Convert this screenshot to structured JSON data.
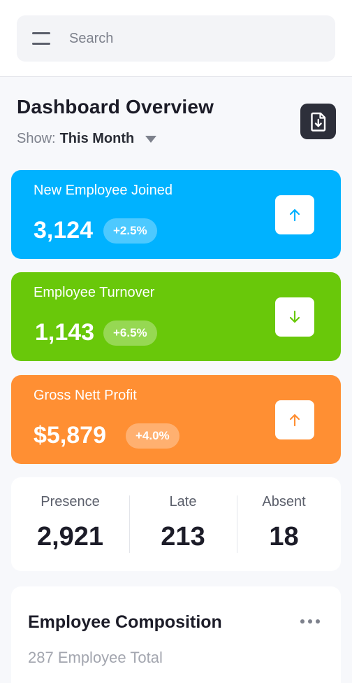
{
  "search": {
    "placeholder": "Search",
    "menu_icon": "hamburger-menu-icon",
    "download_icon": "file-download-icon"
  },
  "header": {
    "title": "Dashboard Overview",
    "show_label": "Show:",
    "show_value": "This Month"
  },
  "cards": [
    {
      "label": "New Employee Joined",
      "value": "3,124",
      "change": "+2.5%",
      "trend_icon": "arrow-up-icon",
      "color": "#00b2ff"
    },
    {
      "label": "Employee Turnover",
      "value": "1,143",
      "change": "+6.5%",
      "trend_icon": "arrow-down-icon",
      "color": "#69c80a"
    },
    {
      "label": "Gross Nett Profit",
      "value": "$5,879",
      "change": "+4.0%",
      "trend_icon": "arrow-up-icon",
      "color": "#ff8f33"
    }
  ],
  "attendance": [
    {
      "label": "Presence",
      "value": "2,921"
    },
    {
      "label": "Late",
      "value": "213"
    },
    {
      "label": "Absent",
      "value": "18"
    }
  ],
  "composition": {
    "title": "Employee Composition",
    "subtitle": "287 Employee Total",
    "more_icon": "more-horizontal-icon"
  }
}
